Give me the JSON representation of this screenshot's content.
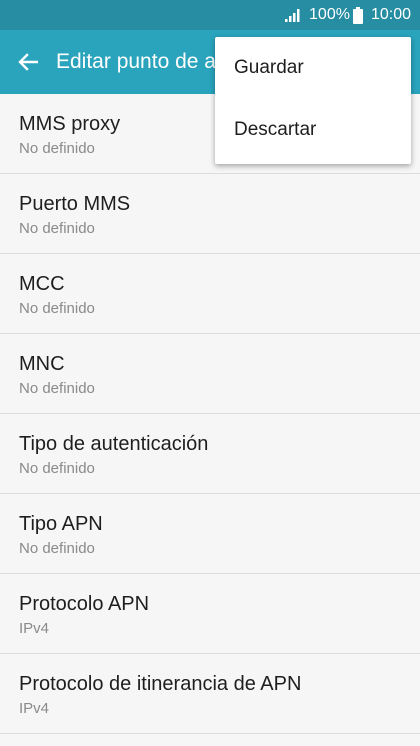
{
  "status_bar": {
    "battery_text": "100%",
    "time": "10:00",
    "battery_level": 1.0
  },
  "app_bar": {
    "title": "Editar punto de acceso"
  },
  "menu": {
    "items": [
      {
        "label": "Guardar"
      },
      {
        "label": "Descartar"
      }
    ]
  },
  "settings": [
    {
      "title": "MMS proxy",
      "value": "No definido"
    },
    {
      "title": "Puerto MMS",
      "value": "No definido"
    },
    {
      "title": "MCC",
      "value": "No definido"
    },
    {
      "title": "MNC",
      "value": "No definido"
    },
    {
      "title": "Tipo de autenticación",
      "value": "No definido"
    },
    {
      "title": "Tipo APN",
      "value": "No definido"
    },
    {
      "title": "Protocolo APN",
      "value": "IPv4"
    },
    {
      "title": "Protocolo de itinerancia de APN",
      "value": "IPv4"
    }
  ],
  "colors": {
    "status_bar": "#268da3",
    "app_bar": "#2aa4bd"
  },
  "icons": {
    "back": "arrow-back-icon",
    "signal": "signal-icon",
    "battery": "battery-icon"
  }
}
